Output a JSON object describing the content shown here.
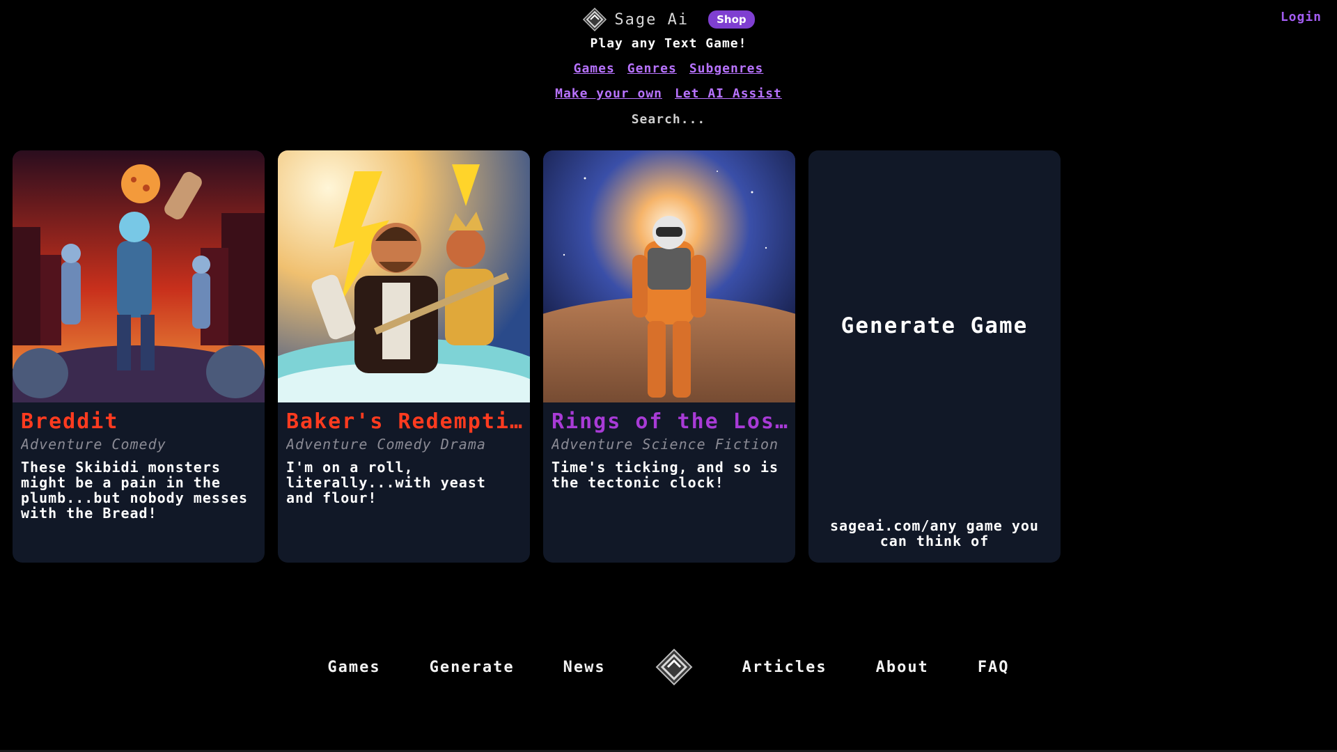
{
  "header": {
    "brand_name": "Sage Ai",
    "shop_label": "Shop",
    "login_label": "Login",
    "tagline": "Play any Text Game!",
    "nav_row1": [
      "Games",
      "Genres",
      "Subgenres"
    ],
    "nav_row2": [
      "Make your own",
      "Let AI Assist"
    ],
    "search_placeholder": "Search..."
  },
  "cards": [
    {
      "title": "Breddit",
      "title_color": "#ff3b1f",
      "genres": "Adventure Comedy",
      "description": "These Skibidi monsters might be a pain in the plumb...but nobody messes with the Bread!"
    },
    {
      "title": "Baker's Redemption",
      "title_color": "#ff3b1f",
      "genres": "Adventure Comedy Drama",
      "description": "I'm on a roll, literally...with yeast and flour!"
    },
    {
      "title": "Rings of the Lost",
      "title_color": "#a83bd6",
      "genres": "Adventure Science Fiction",
      "description": "Time's ticking, and so is the tectonic clock!"
    }
  ],
  "generate_card": {
    "title": "Generate Game",
    "subtitle": "sageai.com/any game you can think of"
  },
  "footer": {
    "links_left": [
      "Games",
      "Generate",
      "News"
    ],
    "links_right": [
      "Articles",
      "About",
      "FAQ"
    ]
  },
  "colors": {
    "background": "#000000",
    "card_bg": "#111827",
    "accent": "#7f3fd1",
    "link": "#b873ff"
  }
}
